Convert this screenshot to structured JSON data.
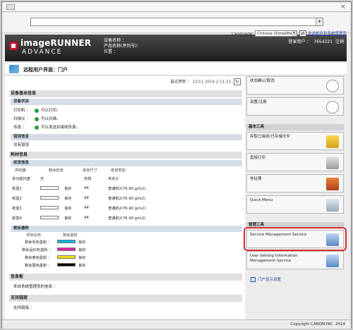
{
  "browser": {
    "address_value": ""
  },
  "header": {
    "brand_line1": "imageRUNNER",
    "brand_line2": "ADVANCE",
    "device_name_label": "设备名称 ：",
    "product_name_label": "产品名称(序列号)：",
    "location_label": "位置 ：",
    "login_label": "登录用户 ：",
    "login_user_id": "7654321",
    "logout_label": "注销",
    "language_label": "Language:",
    "language_value": "Chinese (Simplified)",
    "mail_link": "发送邮件到系统管理员"
  },
  "page": {
    "title": "远程用户界面：门户",
    "last_updated": "最近更新 ： 12/11 2014 2:11:23"
  },
  "device_basic": {
    "section_title": "设备基本信息",
    "status_subtitle": "设备状态",
    "rows": [
      {
        "label": "打印机 ：",
        "status": "可以打印。"
      },
      {
        "label": "扫描仪 ：",
        "status": "可以扫描。"
      },
      {
        "label": "传真 ：",
        "status": "可以发送并接收传真。"
      }
    ],
    "error_subtitle": "错误信息",
    "error_text": "没有错误"
  },
  "consumables": {
    "section_title": "耗材信息",
    "paper_subtitle": "纸张信息",
    "paper_headers": [
      "供纸器",
      "剩余纸张",
      "纸张尺寸",
      "纸张类型"
    ],
    "paper_rows": [
      {
        "name": "多功能托盘",
        "remain": "无",
        "size": "未知",
        "type": "未定义"
      },
      {
        "name": "纸盒1",
        "remain": "良好",
        "size": "A4",
        "type": "普通纸2(76-90 g/m2)"
      },
      {
        "name": "纸盒2",
        "remain": "良好",
        "size": "A4",
        "type": "普通纸2(76-90 g/m2)"
      },
      {
        "name": "纸盒3",
        "remain": "良好",
        "size": "A4",
        "type": "普通纸2(76-90 g/m2)"
      },
      {
        "name": "纸盒4",
        "remain": "良好",
        "size": "A4",
        "type": "普通纸2(76-90 g/m2)"
      }
    ],
    "toner_subtitle": "剩余墨粉",
    "toner_headers": [
      "项目名称",
      "剩余墨粉"
    ],
    "toner_rows": [
      {
        "name": "剩余青色墨粉 ：",
        "status": "良好",
        "color": "#00b8d8"
      },
      {
        "name": "剩余品红色墨粉 ：",
        "status": "良好",
        "color": "#e020a8"
      },
      {
        "name": "剩余黄色墨粉 ：",
        "status": "良好",
        "color": "#f0e000"
      },
      {
        "name": "剩余黑色墨粉 ：",
        "status": "良好",
        "color": "#000000"
      }
    ]
  },
  "message": {
    "section_title": "信息板",
    "text": "来自系统管理员的信息 ："
  },
  "support": {
    "section_title": "支持链接",
    "text": "支持链接 ："
  },
  "sidebar": {
    "status_btn": "状态确认/取消",
    "settings_btn": "设置/注册",
    "basic_tools_title": "基本工具",
    "received_btn": "存取已接收/已存储文件",
    "direct_print_btn": "直接打印",
    "address_book_btn": "地址簿",
    "quick_menu_btn": "Quick Menu",
    "admin_tools_title": "管理工具",
    "sms_btn": "Service Management Service",
    "user_setting_btn_line1": "User Setting Information",
    "user_setting_btn_line2": "Management Service",
    "portal_display_link": "门户显示设置"
  },
  "footer": {
    "copyright": "Copyright CANON INC. 2014"
  }
}
